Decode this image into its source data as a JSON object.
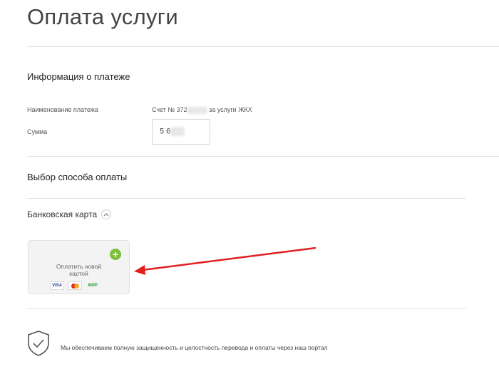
{
  "page": {
    "title": "Оплата услуги"
  },
  "payment_info": {
    "heading": "Информация о платеже",
    "name_label": "Наименование платежа",
    "name_value_prefix": "Счет № 372",
    "name_value_suffix": "за услуги ЖКХ",
    "amount_label": "Сумма",
    "amount_value": "5 6"
  },
  "payment_method": {
    "heading": "Выбор способа оплаты",
    "bank_card_label": "Банковская карта",
    "toggle_icon": "chevron-up-icon",
    "new_card_label": "Оплатить новой картой",
    "add_icon": "plus-circle-icon",
    "card_logos": [
      "VISA",
      "MasterCard",
      "МИР"
    ]
  },
  "security": {
    "icon": "shield-check-icon",
    "text": "Мы обеспечиваем полную защищенность и целостность перевода и оплаты через наш портал"
  },
  "colors": {
    "accent_green": "#7ebf3f",
    "arrow_red": "#e02020"
  }
}
